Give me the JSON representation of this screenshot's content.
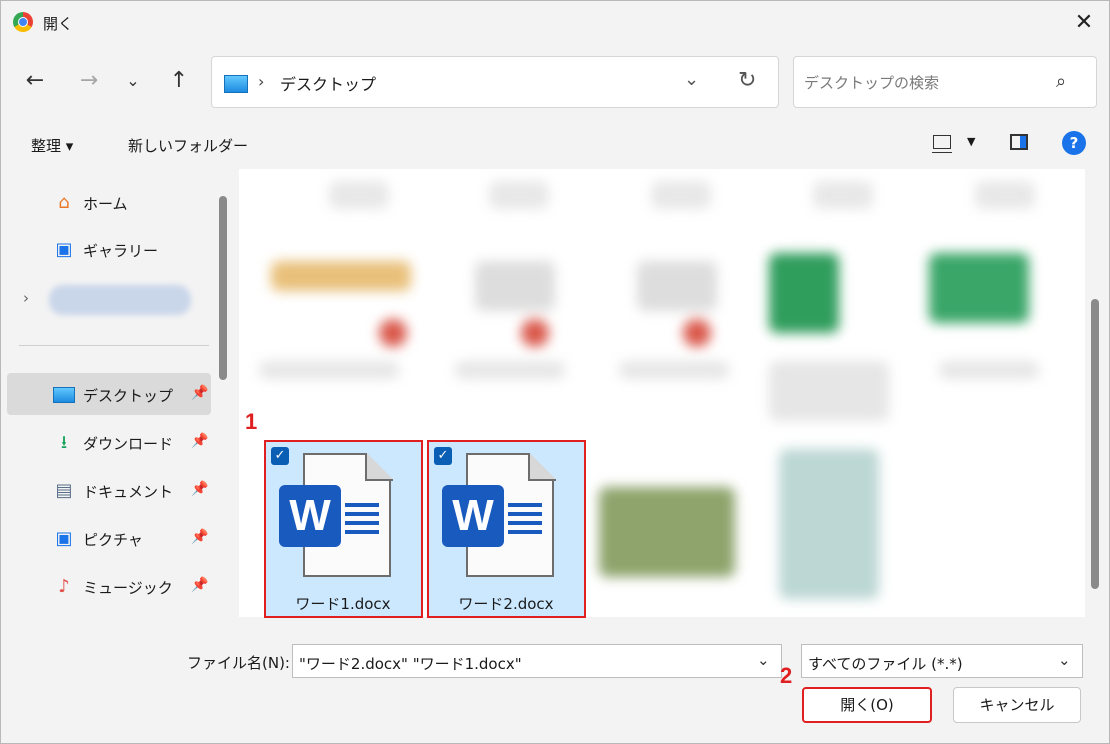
{
  "window": {
    "title": "開く"
  },
  "nav": {
    "path_label": "デスクトップ",
    "search_placeholder": "デスクトップの検索"
  },
  "toolbar": {
    "organize": "整理 ▾",
    "new_folder": "新しいフォルダー"
  },
  "sidebar": {
    "items": [
      {
        "label": "ホーム",
        "icon": "home-icon"
      },
      {
        "label": "ギャラリー",
        "icon": "gallery-icon"
      },
      {
        "label": "デスクトップ",
        "icon": "desktop-folder-icon",
        "pinned": true,
        "active": true
      },
      {
        "label": "ダウンロード",
        "icon": "download-icon",
        "pinned": true
      },
      {
        "label": "ドキュメント",
        "icon": "documents-icon",
        "pinned": true
      },
      {
        "label": "ピクチャ",
        "icon": "pictures-icon",
        "pinned": true
      },
      {
        "label": "ミュージック",
        "icon": "music-icon",
        "pinned": true
      }
    ]
  },
  "files": [
    {
      "name": "ワード1.docx",
      "selected": true
    },
    {
      "name": "ワード2.docx",
      "selected": true
    }
  ],
  "footer": {
    "filename_label": "ファイル名(N):",
    "filename_value": "\"ワード2.docx\" \"ワード1.docx\"",
    "filetype_value": "すべてのファイル (*.*)",
    "open_button": "開く(O)",
    "cancel_button": "キャンセル"
  },
  "annotations": {
    "step1": "1",
    "step2": "2"
  },
  "colors": {
    "accent": "#1a73e8",
    "selection": "#cce8ff",
    "annotation": "#e02020",
    "word_blue": "#185abd"
  }
}
